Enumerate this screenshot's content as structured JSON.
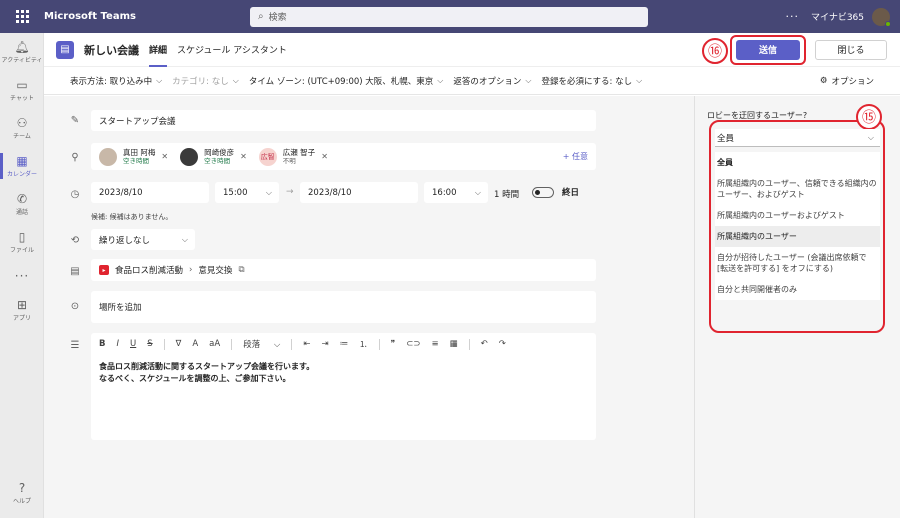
{
  "app": {
    "title": "Microsoft Teams",
    "user": "マイナビ365"
  },
  "search": {
    "placeholder": "検索"
  },
  "rail": {
    "items": [
      {
        "label": "アクティビティ",
        "icon": "bell-icon"
      },
      {
        "label": "チャット",
        "icon": "chat-icon"
      },
      {
        "label": "チーム",
        "icon": "teams-icon"
      },
      {
        "label": "カレンダー",
        "icon": "calendar-icon"
      },
      {
        "label": "通話",
        "icon": "phone-icon"
      },
      {
        "label": "ファイル",
        "icon": "file-icon"
      },
      {
        "label": "アプリ",
        "icon": "apps-icon"
      }
    ],
    "help": "ヘルプ"
  },
  "header": {
    "title": "新しい会議",
    "tabs": [
      "詳細",
      "スケジュール アシスタント"
    ],
    "send": "送信",
    "close": "閉じる",
    "badge_send": "⑯",
    "badge_side": "⑮"
  },
  "toolbar": {
    "display": "表示方法: 取り込み中",
    "category": "カテゴリ: なし",
    "timezone": "タイム ゾーン: (UTC+09:00) 大阪、札幌、東京",
    "reply": "返答のオプション",
    "registration": "登録を必須にする: なし",
    "options": "オプション"
  },
  "form": {
    "title": "スタートアップ会議",
    "attendees": [
      {
        "name": "真田 阿梅",
        "status": "空き時間",
        "initials": ""
      },
      {
        "name": "岡崎俊彦",
        "status": "空き時間",
        "initials": ""
      },
      {
        "name": "広瀬 智子",
        "status": "不明",
        "initials": "広智"
      }
    ],
    "optional": "+ 任意",
    "start_date": "2023/8/10",
    "start_time": "15:00",
    "end_date": "2023/8/10",
    "end_time": "16:00",
    "duration": "1 時間",
    "all_day": "終日",
    "suggestion": "候補: 候補はありません。",
    "repeat": "繰り返しなし",
    "channel": "食品ロス削減活動",
    "channel_sub": "意見交換",
    "location_placeholder": "場所を追加",
    "editor_para": "段落",
    "body_line1": "食品ロス削減活動に関するスタートアップ会議を行います。",
    "body_line2": "なるべく、スケジュールを調整の上、ご参加下さい。"
  },
  "side": {
    "label": "ロビーを迂回するユーザー?",
    "selected": "全員",
    "options": [
      "全員",
      "所属組織内のユーザー、信頼できる組織内のユーザー、およびゲスト",
      "所属組織内のユーザーおよびゲスト",
      "所属組織内のユーザー",
      "自分が招待したユーザー (会議出席依頼で [転送を許可する] をオフにする)",
      "自分と共同開催者のみ"
    ]
  },
  "colors": {
    "topbar": "#464775",
    "accent": "#5b5fc7",
    "highlight": "#e0242f"
  }
}
